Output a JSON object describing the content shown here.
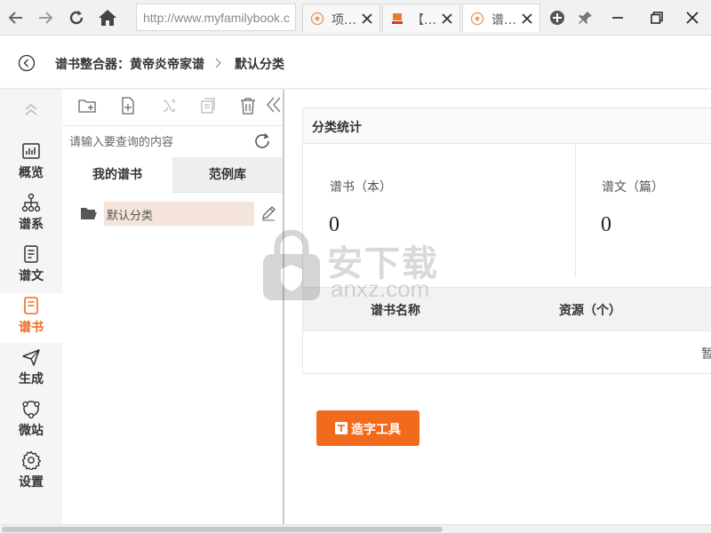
{
  "browser": {
    "url": "http://www.myfamilybook.c",
    "tabs": [
      {
        "title": "项…",
        "active": false,
        "icon": "flower-favicon"
      },
      {
        "title": "【…",
        "active": false,
        "icon": "site-favicon"
      },
      {
        "title": "谱…",
        "active": true,
        "icon": "flower-favicon"
      }
    ]
  },
  "header": {
    "crumb1": "谱书整合器：黄帝炎帝家谱",
    "crumb2": "默认分类"
  },
  "leftnav": {
    "items": [
      {
        "label": "概览",
        "icon": "chart-icon",
        "active": false
      },
      {
        "label": "谱系",
        "icon": "tree-icon",
        "active": false
      },
      {
        "label": "谱文",
        "icon": "document-icon",
        "active": false
      },
      {
        "label": "谱书",
        "icon": "book-icon",
        "active": true
      },
      {
        "label": "生成",
        "icon": "send-icon",
        "active": false
      },
      {
        "label": "微站",
        "icon": "network-icon",
        "active": false
      },
      {
        "label": "设置",
        "icon": "gear-icon",
        "active": false
      }
    ]
  },
  "tree": {
    "search_placeholder": "请输入要查询的内容",
    "tab_mine": "我的谱书",
    "tab_sample": "范例库",
    "node_label": "默认分类"
  },
  "main": {
    "stats_title": "分类统计",
    "stat_books_label": "谱书（本）",
    "stat_books_value": "0",
    "stat_articles_label": "谱文（篇）",
    "stat_articles_value": "0",
    "col_name": "谱书名称",
    "col_resource": "资源（个）",
    "empty_text": "暂",
    "font_tool_label": "造字工具"
  },
  "watermark": {
    "cn": "安下载",
    "en": "anxz.com"
  },
  "colors": {
    "accent": "#f26a1b",
    "node_highlight": "#f4e4da"
  }
}
